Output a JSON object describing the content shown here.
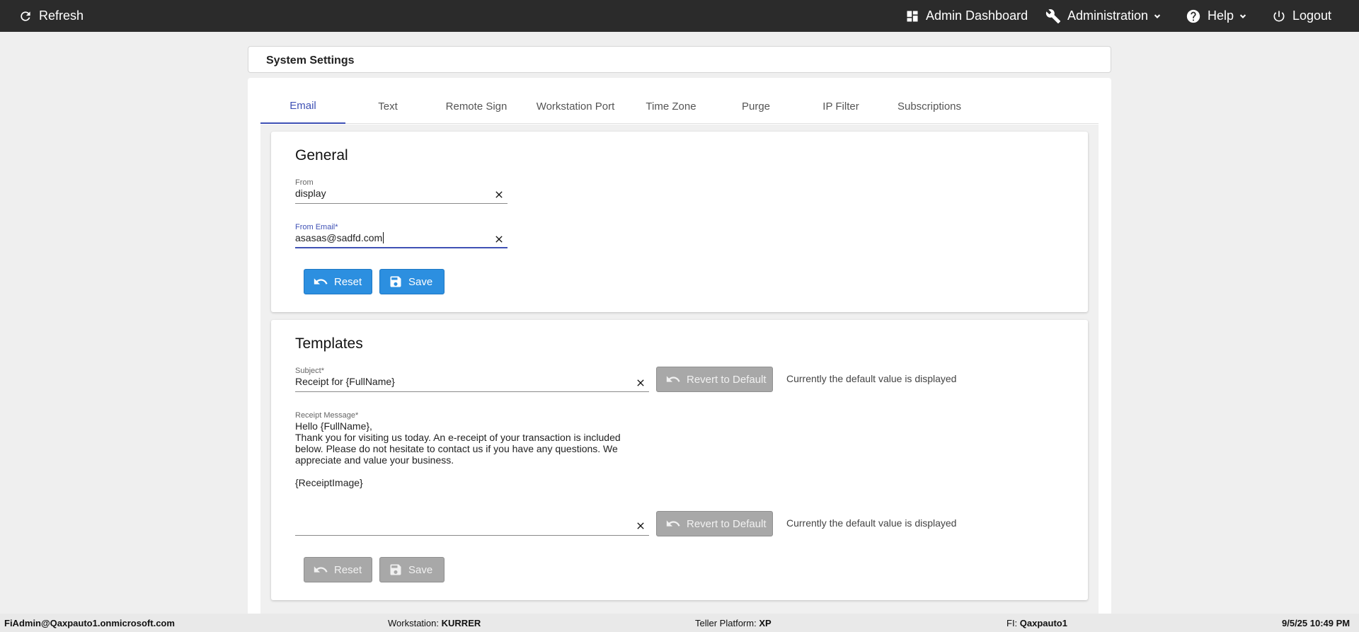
{
  "topbar": {
    "refresh": "Refresh",
    "admin_dashboard": "Admin Dashboard",
    "administration": "Administration",
    "help": "Help",
    "logout": "Logout"
  },
  "page": {
    "title": "System Settings"
  },
  "tabs": [
    {
      "label": "Email",
      "active": true
    },
    {
      "label": "Text"
    },
    {
      "label": "Remote Sign"
    },
    {
      "label": "Workstation Port"
    },
    {
      "label": "Time Zone"
    },
    {
      "label": "Purge"
    },
    {
      "label": "IP Filter"
    },
    {
      "label": "Subscriptions"
    }
  ],
  "general": {
    "title": "General",
    "from": {
      "label": "From",
      "value": "display"
    },
    "from_email": {
      "label": "From Email",
      "required_mark": "*",
      "value": "asasas@sadfd.com"
    },
    "reset_label": "Reset",
    "save_label": "Save"
  },
  "templates": {
    "title": "Templates",
    "subject": {
      "label": "Subject",
      "required_mark": "*",
      "value": "Receipt for {FullName}"
    },
    "receipt_message": {
      "label": "Receipt Message",
      "required_mark": "*",
      "line1": "Hello {FullName},",
      "line2": "Thank you for visiting us today. An e-receipt of your transaction is included",
      "line3": "below. Please do not hesitate to contact us if you have any questions. We",
      "line4": "appreciate and value your business.",
      "line5": "{ReceiptImage}"
    },
    "revert_label": "Revert to Default",
    "default_note": "Currently the default value is displayed",
    "reset_label": "Reset",
    "save_label": "Save"
  },
  "footer": {
    "user": "FiAdmin@Qaxpauto1.onmicrosoft.com",
    "workstation_label": "Workstation:",
    "workstation_value": "KURRER",
    "teller_label": "Teller Platform:",
    "teller_value": "XP",
    "fi_label": "FI:",
    "fi_value": "Qaxpauto1",
    "datetime": "9/5/25 10:49 PM"
  },
  "colors": {
    "topbar": "#2b2b2b",
    "accent": "#3f51b5",
    "primary_button": "#2c8fe0",
    "disabled_button": "#a8a8a8"
  }
}
